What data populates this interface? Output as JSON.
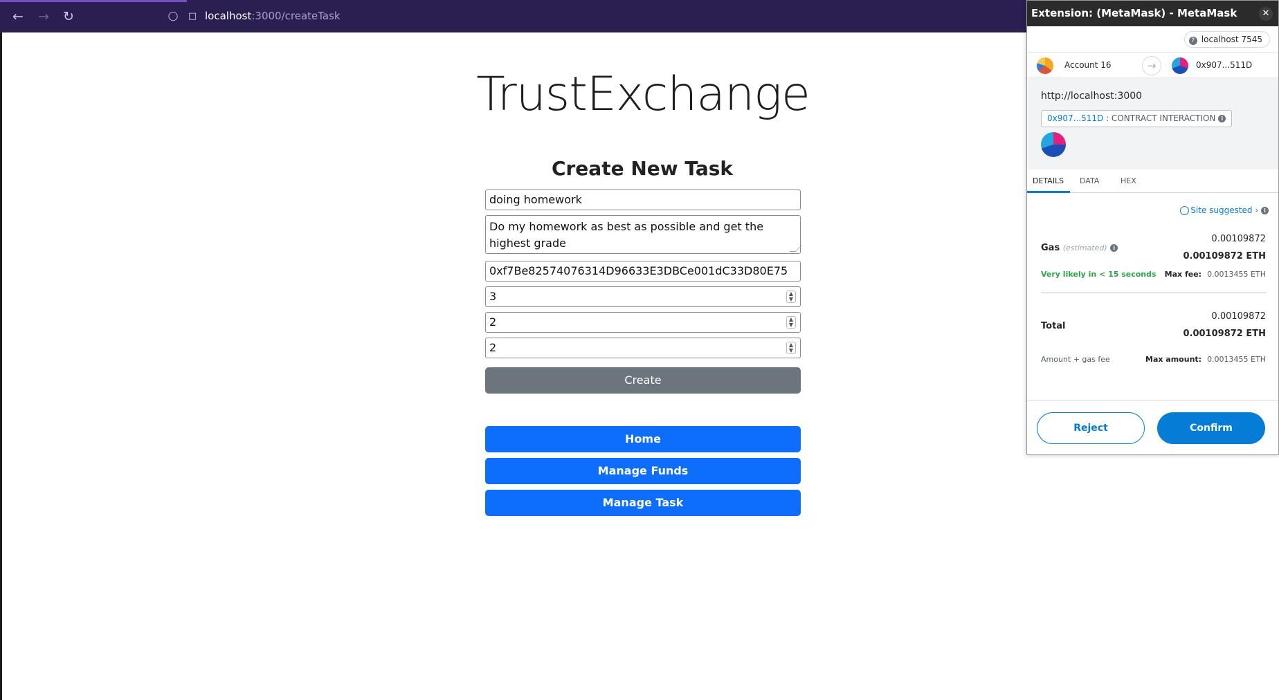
{
  "browser": {
    "url_host": "localhost",
    "url_path": ":3000/createTask"
  },
  "page": {
    "site_title": "TrustExchange",
    "form_title": "Create New Task",
    "fields": {
      "task_name": "doing homework",
      "description": "Do my homework as best as possible and get the highest grade",
      "address": "0xf7Be82574076314D96633E3DBCe001dC33D80E75",
      "number_1": "3",
      "number_2": "2",
      "number_3": "2"
    },
    "create_label": "Create",
    "nav_buttons": [
      "Home",
      "Manage Funds",
      "Manage Task"
    ]
  },
  "metamask": {
    "window_title": "Extension: (MetaMask) - MetaMask Notifica...",
    "network": "localhost 7545",
    "from_account": "Account 16",
    "to_account": "0x907...511D",
    "origin": "http://localhost:3000",
    "contract_address": "0x907...511D",
    "contract_label": ": CONTRACT INTERACTION",
    "tabs": [
      "DETAILS",
      "DATA",
      "HEX"
    ],
    "site_suggested": "Site suggested",
    "gas_label": "Gas",
    "gas_estimated": "(estimated)",
    "gas_value": "0.00109872",
    "gas_value_eth": "0.00109872 ETH",
    "likely_text": "Very likely in < 15 seconds",
    "max_fee_label": "Max fee:",
    "max_fee_value": "0.0013455 ETH",
    "total_label": "Total",
    "total_value": "0.00109872",
    "total_value_eth": "0.00109872 ETH",
    "amount_gas_label": "Amount + gas fee",
    "max_amount_label": "Max amount:",
    "max_amount_value": "0.0013455 ETH",
    "reject_label": "Reject",
    "confirm_label": "Confirm"
  }
}
